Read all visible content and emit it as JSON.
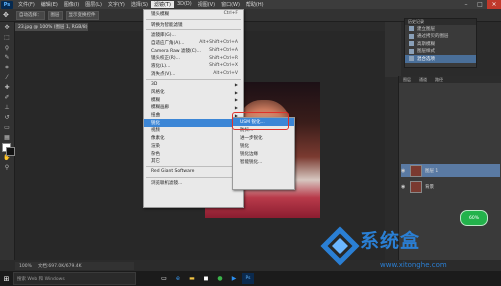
{
  "menubar": {
    "logo": "Ps",
    "items": [
      "文件(F)",
      "编辑(E)",
      "图像(I)",
      "图层(L)",
      "文字(Y)",
      "选择(S)",
      "滤镜(T)",
      "3D(D)",
      "视图(V)",
      "窗口(W)",
      "帮助(H)"
    ],
    "active_index": 6
  },
  "optbar": {
    "auto_select": "自动选择：",
    "layer": "图层",
    "show_transform": "显示变换控件"
  },
  "document": {
    "tab": "23.jpg @ 100% (图层 1, RGB/8)"
  },
  "filter_menu": {
    "items": [
      {
        "label": "镜头模糊",
        "shortcut": "Ctrl+F"
      },
      {
        "sep": true
      },
      {
        "label": "转换为智能滤镜"
      },
      {
        "sep": true
      },
      {
        "label": "滤镜库(G)..."
      },
      {
        "label": "自适应广角(A)...",
        "shortcut": "Alt+Shift+Ctrl+A"
      },
      {
        "label": "Camera Raw 滤镜(C)...",
        "shortcut": "Shift+Ctrl+A"
      },
      {
        "label": "镜头校正(R)...",
        "shortcut": "Shift+Ctrl+R"
      },
      {
        "label": "液化(L)...",
        "shortcut": "Shift+Ctrl+X"
      },
      {
        "label": "消失点(V)...",
        "shortcut": "Alt+Ctrl+V"
      },
      {
        "sep": true
      },
      {
        "label": "3D",
        "sub": true
      },
      {
        "label": "风格化",
        "sub": true
      },
      {
        "label": "模糊",
        "sub": true
      },
      {
        "label": "模糊画廊",
        "sub": true
      },
      {
        "label": "扭曲",
        "sub": true
      },
      {
        "label": "锐化",
        "sub": true,
        "highlight": true
      },
      {
        "label": "视频",
        "sub": true
      },
      {
        "label": "像素化",
        "sub": true
      },
      {
        "label": "渲染",
        "sub": true
      },
      {
        "label": "杂色",
        "sub": true
      },
      {
        "label": "其它",
        "sub": true
      },
      {
        "sep": true
      },
      {
        "label": "Red Giant Software",
        "sub": true
      },
      {
        "sep": true
      },
      {
        "label": "浏览联机滤镜..."
      }
    ]
  },
  "submenu": {
    "items": [
      "USM 锐化...",
      "防抖...",
      "进一步锐化",
      "锐化",
      "锐化边缘",
      "智能锐化..."
    ],
    "highlight_index": 0
  },
  "history_panel": {
    "title": "历史记录",
    "items": [
      "建立图层",
      "通过拷贝的图层",
      "高斯模糊",
      "图层样式",
      "混合选项"
    ],
    "selected_index": 4
  },
  "layers_panel": {
    "tabs": [
      "图层",
      "通道",
      "路径"
    ],
    "layers": [
      "图层 1",
      "背景"
    ],
    "selected_index": 0
  },
  "status": {
    "zoom": "100%",
    "doc": "文档:697.0K/679.4K"
  },
  "taskbar": {
    "search_placeholder": "搜索 Web 和 Windows"
  },
  "green_widget": "60%",
  "watermark": {
    "text": "系统盒",
    "url": "www.xitonghe.com"
  },
  "colors": {
    "highlight": "#3c86d6",
    "red_outline": "#e0312a",
    "watermark": "#2a7fd4"
  }
}
